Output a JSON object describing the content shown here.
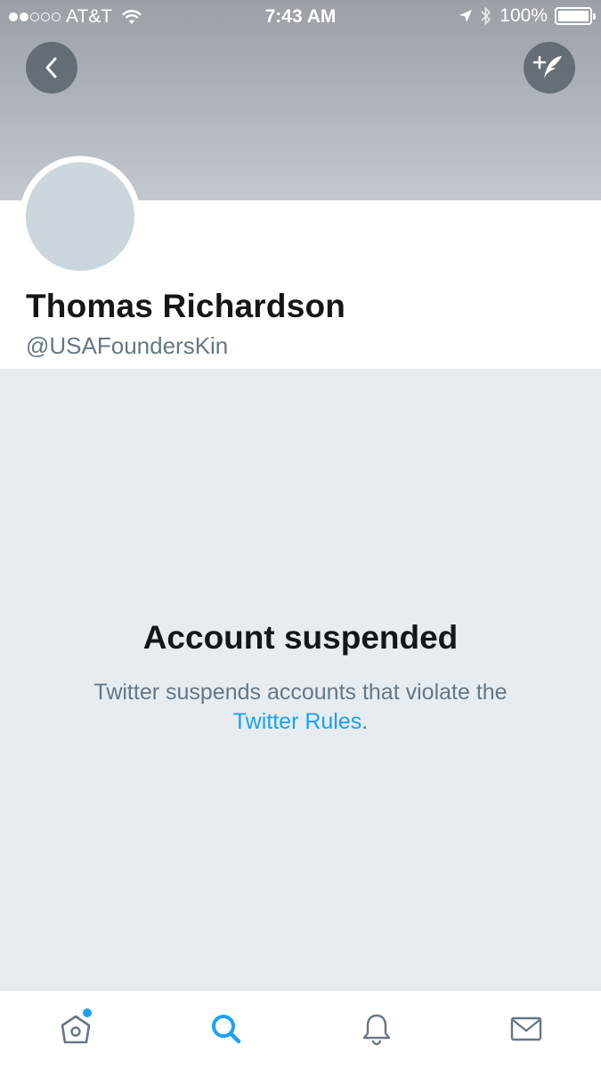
{
  "status_bar": {
    "carrier": "AT&T",
    "time": "7:43 AM",
    "battery": "100%",
    "signal_icon": "signal-dots-icon",
    "wifi_icon": "wifi-icon",
    "location_icon": "location-arrow-icon",
    "bluetooth_icon": "bluetooth-icon"
  },
  "header": {
    "back_icon": "chevron-left-icon",
    "compose_icon": "compose-tweet-icon"
  },
  "profile": {
    "name": "Thomas Richardson",
    "handle": "@USAFoundersKin"
  },
  "suspended": {
    "title": "Account suspended",
    "message": "Twitter suspends accounts that violate the",
    "link_text": "Twitter Rules",
    "suffix": "."
  },
  "tabbar": {
    "tabs": [
      {
        "icon": "home-icon",
        "active": false,
        "has_badge": true
      },
      {
        "icon": "search-icon",
        "active": true,
        "has_badge": false
      },
      {
        "icon": "bell-icon",
        "active": false,
        "has_badge": false
      },
      {
        "icon": "mail-icon",
        "active": false,
        "has_badge": false
      }
    ]
  },
  "colors": {
    "accent": "#1da1f2",
    "background": "#e6ecf0",
    "secondary_text": "#657786",
    "avatar_placeholder": "#ccd6dd"
  }
}
